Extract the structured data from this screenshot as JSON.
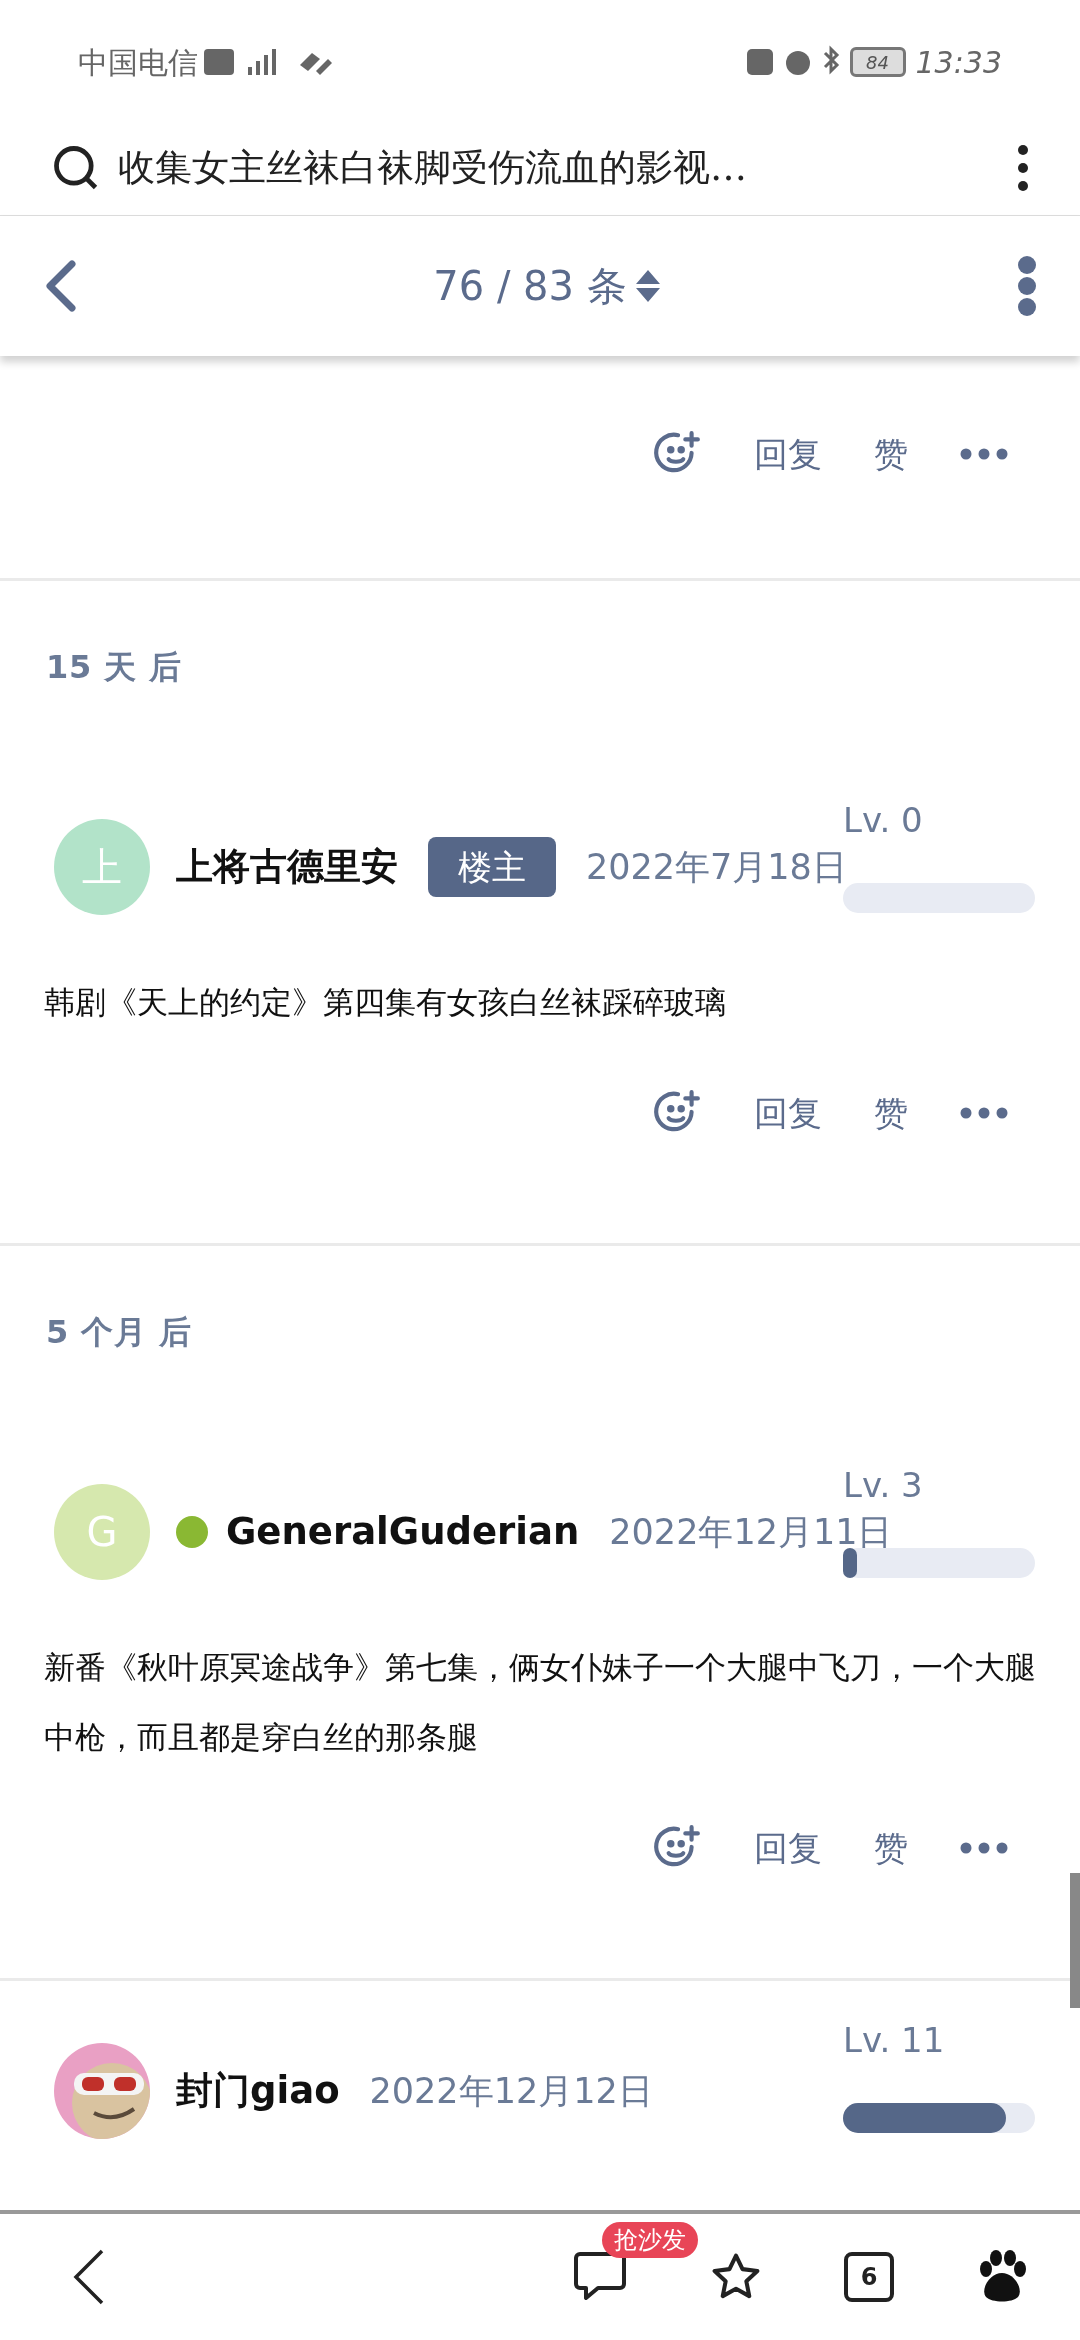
{
  "status_bar": {
    "carrier": "中国电信",
    "battery": "84",
    "time": "13:33"
  },
  "search": {
    "query": "收集女主丝袜白袜脚受伤流血的影视…"
  },
  "header": {
    "counter": "76 / 83 条"
  },
  "posts": [
    {
      "kind": "tail",
      "actions": {
        "reply": "回复",
        "like": "赞"
      }
    },
    {
      "kind": "full",
      "gap": "15 天 后",
      "author": {
        "initial": "上",
        "color": "#b2e3c9",
        "online": false,
        "name": "上将古德里安",
        "badge": "楼主"
      },
      "date": "2022年7月18日",
      "level_label": "Lv. 0",
      "level": 0,
      "body": "韩剧《天上的约定》第四集有女孩白丝袜踩碎玻璃",
      "actions": {
        "reply": "回复",
        "like": "赞"
      }
    },
    {
      "kind": "full",
      "gap": "5 个月 后",
      "author": {
        "initial": "G",
        "color": "#d6e8ae",
        "online": true,
        "name": "GeneralGuderian"
      },
      "date": "2022年12月11日",
      "level_label": "Lv. 3",
      "level": 0.03,
      "body": "新番《秋叶原冥途战争》第七集，俩女仆妹子一个大腿中飞刀，一个大腿中枪，而且都是穿白丝的那条腿",
      "actions": {
        "reply": "回复",
        "like": "赞"
      }
    },
    {
      "kind": "partial",
      "author": {
        "kind": "picture",
        "name": "封门giao"
      },
      "date": "2022年12月12日",
      "level_label": "Lv. 11",
      "level": 0.85
    }
  ],
  "bottom_bar": {
    "comment_badge": "抢沙发",
    "tabs_count": "6"
  }
}
